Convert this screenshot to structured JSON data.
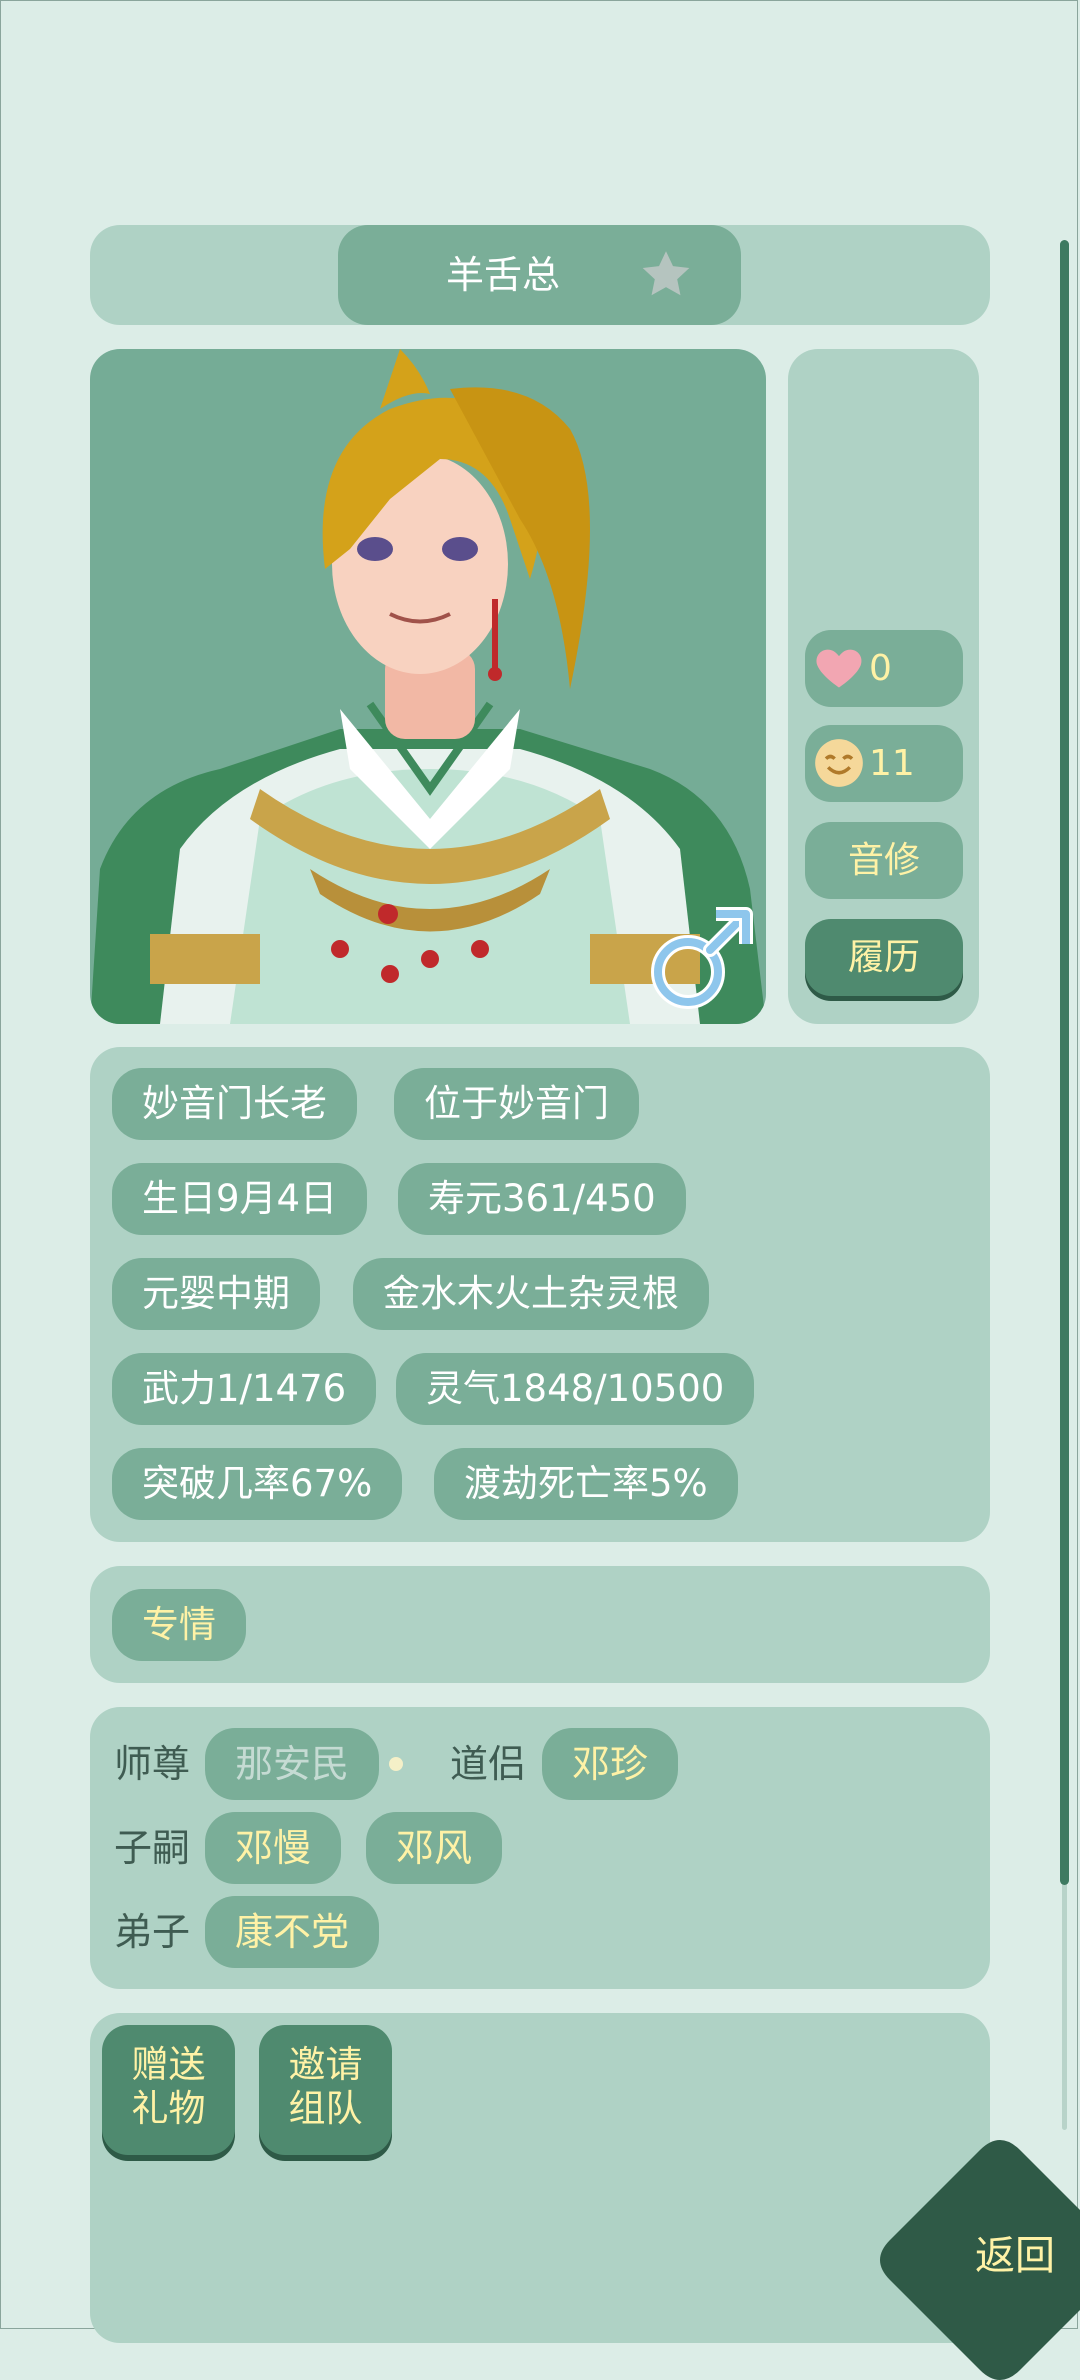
{
  "character": {
    "name": "羊舌总"
  },
  "side": {
    "hearts": "0",
    "mood": "11",
    "path": "音修",
    "history_label": "履历"
  },
  "info_tags": [
    "妙音门长老",
    "位于妙音门",
    "生日9月4日",
    "寿元361/450",
    "元婴中期",
    "金水木火土杂灵根",
    "武力1/1476",
    "灵气1848/10500",
    "突破几率67%",
    "渡劫死亡率5%"
  ],
  "trait": "专情",
  "relations": {
    "master_label": "师尊",
    "master": "那安民",
    "partner_label": "道侣",
    "partner": "邓珍",
    "children_label": "子嗣",
    "children": [
      "邓慢",
      "邓风"
    ],
    "disciples_label": "弟子",
    "disciples": [
      "康不党"
    ]
  },
  "actions": {
    "gift_l1": "赠送",
    "gift_l2": "礼物",
    "invite_l1": "邀请",
    "invite_l2": "组队"
  },
  "back_label": "返回",
  "colors": {
    "panel": "#afd2c5",
    "pill": "#7aae98",
    "dark": "#4f8a6f",
    "gold": "#fff2a6"
  }
}
